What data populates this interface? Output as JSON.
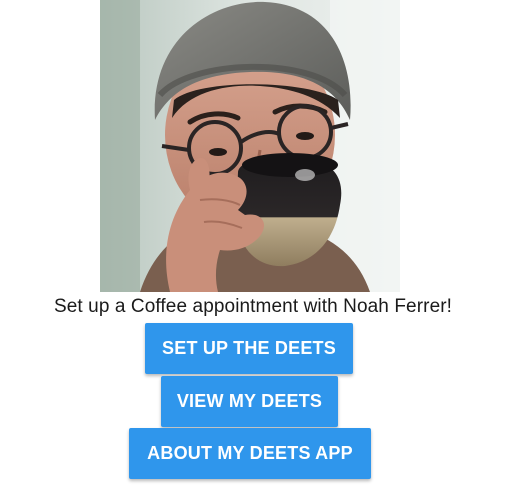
{
  "profile": {
    "photo_icon": "profile-photo",
    "prompt_text": "Set up a Coffee appointment with Noah Ferrer!"
  },
  "actions": {
    "setup_label": "SET UP THE DEETS",
    "view_label": "VIEW MY DEETS",
    "about_label": "ABOUT MY DEETS APP"
  },
  "colors": {
    "button_blue": "#2f96ec",
    "button_text": "#ffffff",
    "background": "#ffffff"
  }
}
